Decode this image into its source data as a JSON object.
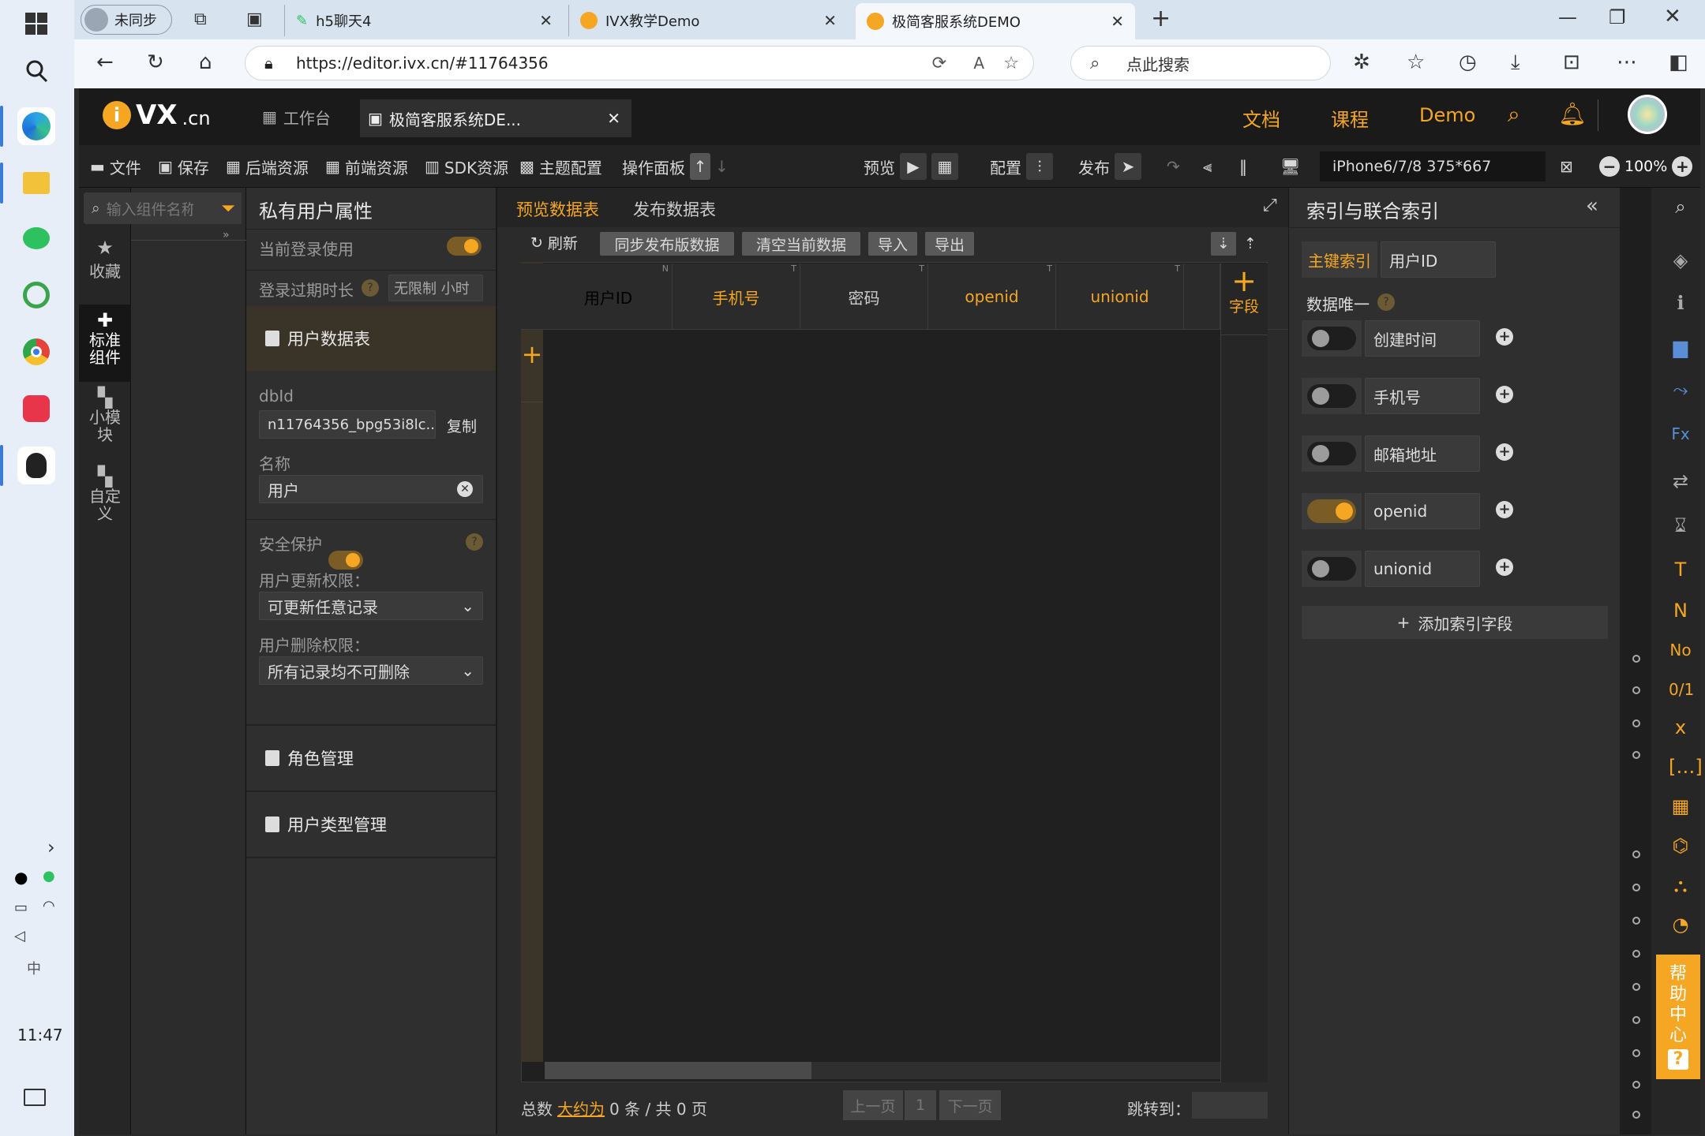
{
  "taskbar": {
    "clock": "11:47"
  },
  "browser": {
    "profile_label": "未同步",
    "tabs": [
      {
        "label": "h5聊天4"
      },
      {
        "label": "IVX教学Demo"
      },
      {
        "label": "极简客服系统DEMO"
      }
    ],
    "url": "https://editor.ivx.cn/#11764356",
    "search_placeholder": "点此搜索"
  },
  "app": {
    "logo": "VX",
    "logo_suffix": ".cn",
    "tabs": [
      {
        "label": "工作台"
      },
      {
        "label": "极简客服系统DE..."
      }
    ],
    "top_links": [
      "文档",
      "课程",
      "Demo"
    ],
    "accent": "#f5a623"
  },
  "toolbar": {
    "file": "文件",
    "save": "保存",
    "backend": "后端资源",
    "frontend": "前端资源",
    "sdk": "SDK资源",
    "theme": "主题配置",
    "panel": "操作面板",
    "preview": "预览",
    "config": "配置",
    "publish": "发布",
    "device": "iPhone6/7/8 375*667",
    "zoom": "100%"
  },
  "leftnav": {
    "search_placeholder": "输入组件名称",
    "items": [
      {
        "label": "收藏"
      },
      {
        "label": "标准组件"
      },
      {
        "label": "小模块"
      },
      {
        "label": "自定义"
      }
    ]
  },
  "props": {
    "title": "私有用户属性",
    "login_use": "当前登录使用",
    "expire_label": "登录过期时长",
    "expire_value": "无限制 小时",
    "section_user": "用户数据表",
    "dbid_label": "dbId",
    "dbid_value": "n11764356_bpg53i8lc...",
    "copy": "复制",
    "name_label": "名称",
    "name_value": "用户",
    "security": "安全保护",
    "update_label": "用户更新权限：",
    "update_value": "可更新任意记录",
    "delete_label": "用户删除权限：",
    "delete_value": "所有记录均不可删除",
    "role": "角色管理",
    "usertype": "用户类型管理"
  },
  "table": {
    "tab_preview": "预览数据表",
    "tab_publish": "发布数据表",
    "refresh": "刷新",
    "sync": "同步发布版数据",
    "clear": "清空当前数据",
    "import": "导入",
    "export": "导出",
    "columns": [
      {
        "label": "用户ID",
        "type": "N",
        "highlight": false
      },
      {
        "label": "手机号",
        "type": "T",
        "highlight": true
      },
      {
        "label": "密码",
        "type": "T",
        "highlight": false
      },
      {
        "label": "openid",
        "type": "T",
        "highlight": true
      },
      {
        "label": "unionid",
        "type": "T",
        "highlight": true
      }
    ],
    "add_field": "字段",
    "footer_total_prefix": "总数",
    "footer_total_link": "大约为",
    "footer_count": "0 条 / 共 0 页",
    "prev": "上一页",
    "page": "1",
    "next": "下一页",
    "jump": "跳转到："
  },
  "index": {
    "title": "索引与联合索引",
    "pk_label": "主键索引",
    "pk_value": "用户ID",
    "unique_label": "数据唯一",
    "rows": [
      {
        "label": "创建时间",
        "on": false
      },
      {
        "label": "手机号",
        "on": false
      },
      {
        "label": "邮箱地址",
        "on": false
      },
      {
        "label": "openid",
        "on": true
      },
      {
        "label": "unionid",
        "on": false
      }
    ],
    "add": "添加索引字段"
  },
  "help": "帮助中心"
}
